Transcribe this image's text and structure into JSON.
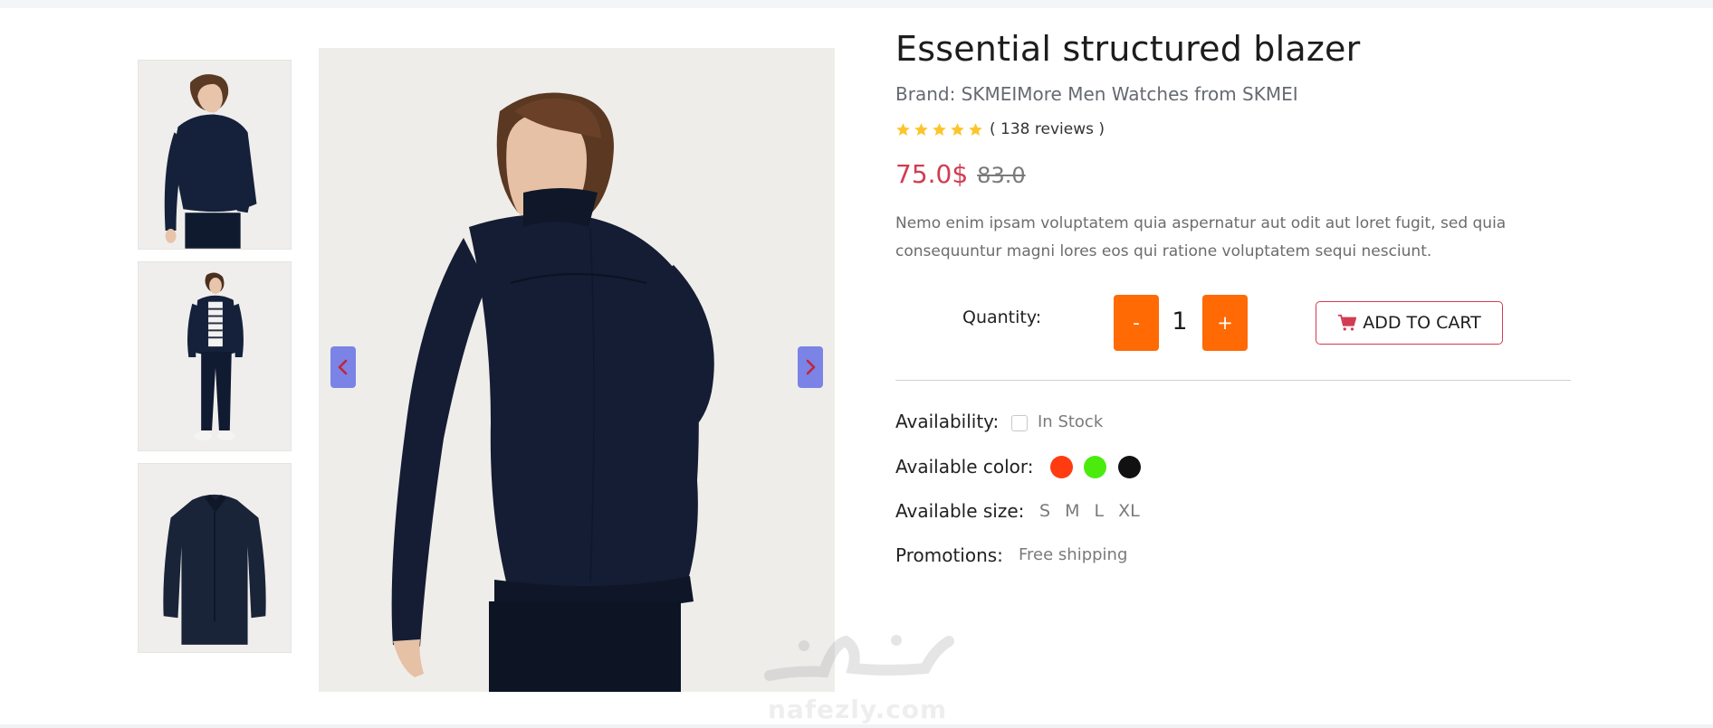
{
  "product": {
    "title": "Essential structured blazer",
    "brand_line": "Brand: SKMEIMore Men Watches from SKMEI",
    "rating": {
      "stars": 5,
      "reviews_text": "( 138 reviews )"
    },
    "price": {
      "current": "75.0$",
      "original": "83.0"
    },
    "description": "Nemo enim ipsam voluptatem quia aspernatur aut odit aut loret fugit, sed quia consequuntur magni lores eos qui ratione voluptatem sequi nesciunt."
  },
  "quantity": {
    "label": "Quantity:",
    "minus_label": "-",
    "plus_label": "+",
    "value": "1"
  },
  "cart": {
    "add_label": "ADD TO CART"
  },
  "details": {
    "availability_label": "Availability:",
    "availability_value": "In Stock",
    "color_label": "Available color:",
    "colors": [
      "#ff3b0f",
      "#4ceb0e",
      "#111111"
    ],
    "size_label": "Available size:",
    "sizes": [
      "S",
      "M",
      "L",
      "XL"
    ],
    "promotions_label": "Promotions:",
    "promotions_value": "Free shipping"
  },
  "gallery": {
    "thumbnails": [
      "jacket-back-view",
      "jacket-full-outfit",
      "jacket-flat-lay"
    ],
    "main_image": "jacket-back-view"
  },
  "theme": {
    "accent": "#ff6a05",
    "price_color": "#d23c51",
    "arrow_bg": "#7b83e6",
    "star_color": "#fbc52d"
  },
  "watermark": {
    "latin": "nafezly.com"
  }
}
